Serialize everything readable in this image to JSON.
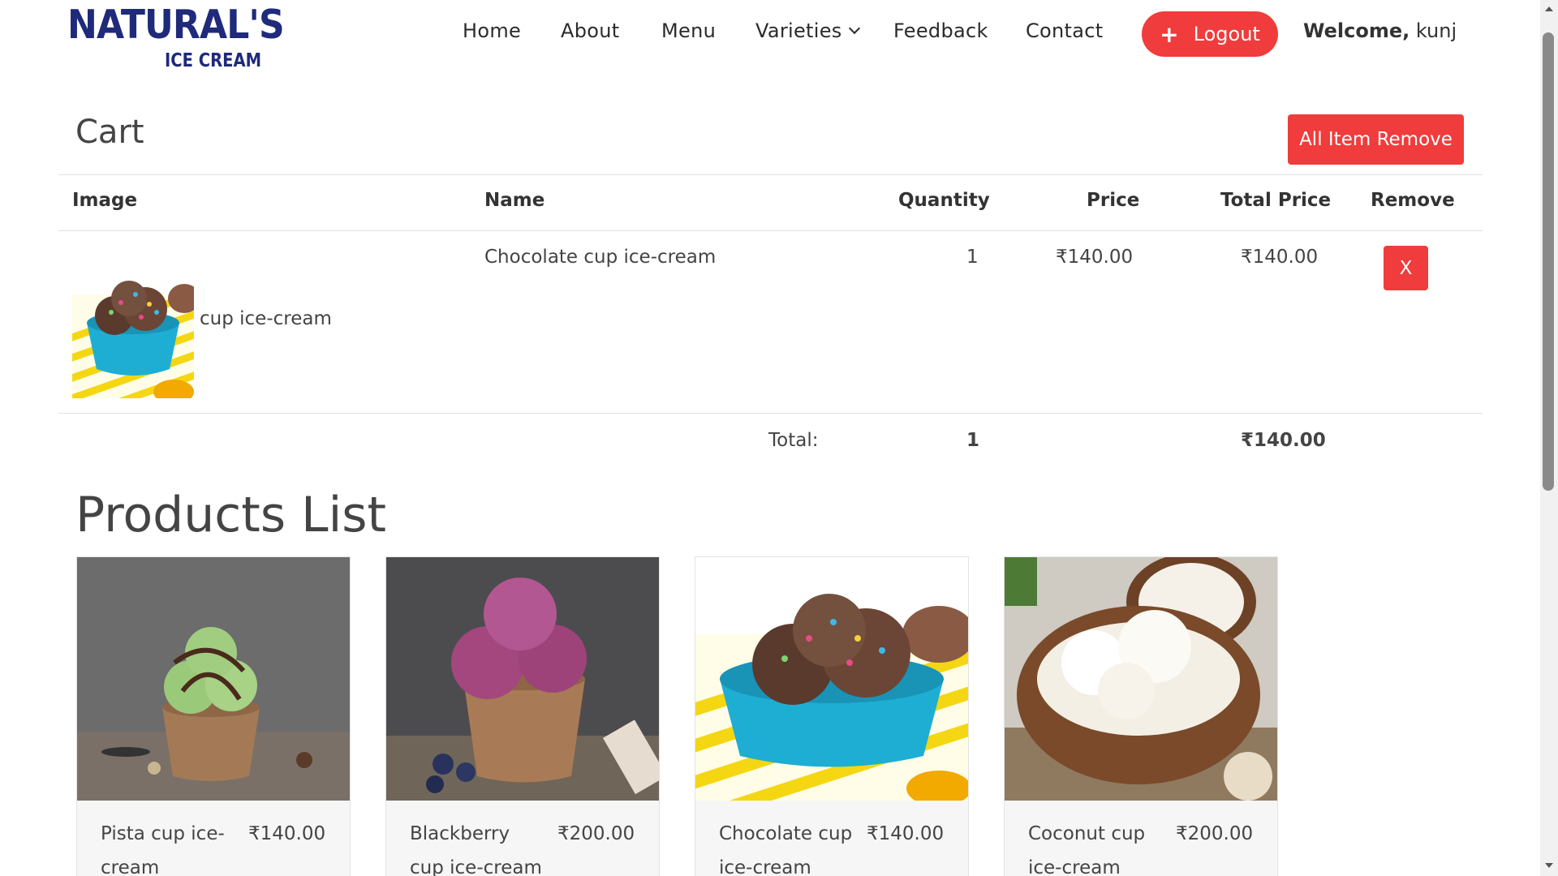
{
  "header": {
    "logo_top": "NATURAL'S",
    "logo_bottom": "ICE CREAM",
    "nav": [
      {
        "label": "Home"
      },
      {
        "label": "About"
      },
      {
        "label": "Menu"
      },
      {
        "label": "Varieties"
      },
      {
        "label": "Feedback"
      },
      {
        "label": "Contact"
      }
    ],
    "logout_label": "Logout",
    "welcome_label": "Welcome,",
    "username": "kunj"
  },
  "cart": {
    "title": "Cart",
    "remove_all_label": "All Item Remove",
    "columns": [
      "Image",
      "Name",
      "Quantity",
      "Price",
      "Total Price",
      "Remove"
    ],
    "items": [
      {
        "image_alt": "cup ice-cream",
        "name": "Chocolate cup ice-cream",
        "quantity": "1",
        "price": "₹140.00",
        "total_price": "₹140.00",
        "remove_label": "X"
      }
    ],
    "total_label": "Total:",
    "total_quantity": "1",
    "total_amount": "₹140.00"
  },
  "products": {
    "title": "Products List",
    "items": [
      {
        "name": "Pista cup ice-cream",
        "price": "₹140.00"
      },
      {
        "name": "Blackberry cup ice-cream",
        "price": "₹200.00"
      },
      {
        "name": "Chocolate cup ice-cream",
        "price": "₹140.00"
      },
      {
        "name": "Coconut cup ice-cream",
        "price": "₹200.00"
      }
    ]
  },
  "colors": {
    "brand": "#1f2a7a",
    "danger": "#f03c3c"
  }
}
